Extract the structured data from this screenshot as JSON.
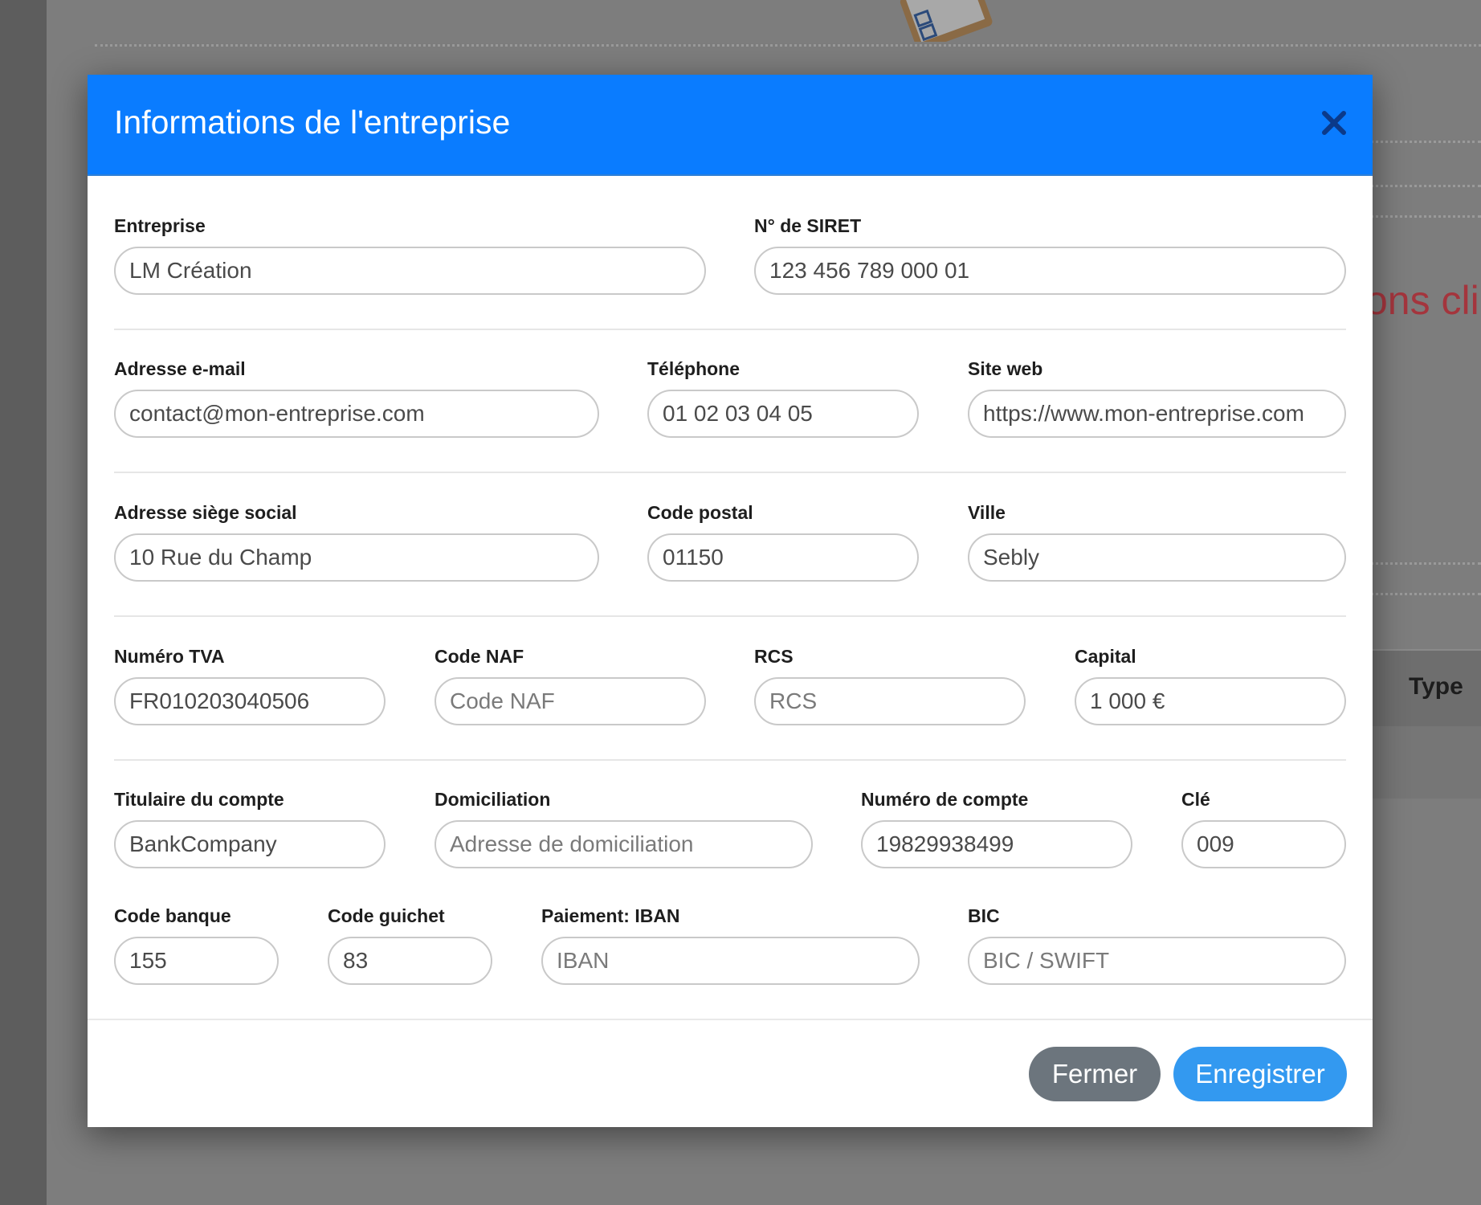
{
  "background": {
    "partial_text": "ons cli",
    "table_header": "Type"
  },
  "modal": {
    "title": "Informations de l'entreprise",
    "close_icon": "close-x-icon",
    "fields": {
      "entreprise": {
        "label": "Entreprise",
        "value": "LM Création",
        "placeholder": ""
      },
      "siret": {
        "label": "N° de SIRET",
        "value": "123 456 789 000 01",
        "placeholder": ""
      },
      "email": {
        "label": "Adresse e-mail",
        "value": "contact@mon-entreprise.com",
        "placeholder": ""
      },
      "telephone": {
        "label": "Téléphone",
        "value": "01 02 03 04 05",
        "placeholder": ""
      },
      "site_web": {
        "label": "Site web",
        "value": "https://www.mon-entreprise.com",
        "placeholder": ""
      },
      "adresse": {
        "label": "Adresse siège social",
        "value": "10 Rue du Champ",
        "placeholder": ""
      },
      "code_postal": {
        "label": "Code postal",
        "value": "01150",
        "placeholder": ""
      },
      "ville": {
        "label": "Ville",
        "value": "Sebly",
        "placeholder": ""
      },
      "tva": {
        "label": "Numéro TVA",
        "value": "FR010203040506",
        "placeholder": ""
      },
      "naf": {
        "label": "Code NAF",
        "value": "",
        "placeholder": "Code NAF"
      },
      "rcs": {
        "label": "RCS",
        "value": "",
        "placeholder": "RCS"
      },
      "capital": {
        "label": "Capital",
        "value": "1 000 €",
        "placeholder": ""
      },
      "titulaire": {
        "label": "Titulaire du compte",
        "value": "BankCompany",
        "placeholder": ""
      },
      "domiciliation": {
        "label": "Domiciliation",
        "value": "",
        "placeholder": "Adresse de domiciliation"
      },
      "numero_compte": {
        "label": "Numéro de compte",
        "value": "19829938499",
        "placeholder": ""
      },
      "cle": {
        "label": "Clé",
        "value": "009",
        "placeholder": ""
      },
      "code_banque": {
        "label": "Code banque",
        "value": "155",
        "placeholder": ""
      },
      "code_guichet": {
        "label": "Code guichet",
        "value": "83",
        "placeholder": ""
      },
      "iban": {
        "label": "Paiement: IBAN",
        "value": "",
        "placeholder": "IBAN"
      },
      "bic": {
        "label": "BIC",
        "value": "",
        "placeholder": "BIC / SWIFT"
      }
    },
    "footer": {
      "close_label": "Fermer",
      "save_label": "Enregistrer"
    }
  },
  "colors": {
    "header": "#0a7cff",
    "close_button": "#6c757d",
    "save_button": "#3399f0"
  }
}
